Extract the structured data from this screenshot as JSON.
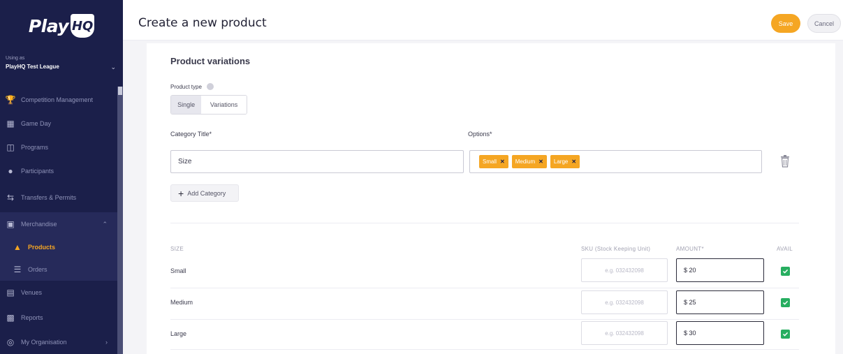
{
  "brand": {
    "play": "Play",
    "hq": "HQ"
  },
  "org": {
    "caption": "Using as",
    "name": "PlayHQ Test League"
  },
  "sidebar": {
    "items": [
      {
        "label": "Competition Management",
        "icon": "trophy-icon"
      },
      {
        "label": "Game Day",
        "icon": "calendar-icon"
      },
      {
        "label": "Programs",
        "icon": "book-icon"
      },
      {
        "label": "Participants",
        "icon": "people-icon"
      },
      {
        "label": "Transfers & Permits",
        "icon": "transfer-icon"
      },
      {
        "label": "Merchandise",
        "icon": "box-icon"
      },
      {
        "label": "Products",
        "icon": "shirt-icon"
      },
      {
        "label": "Orders",
        "icon": "list-icon"
      },
      {
        "label": "Venues",
        "icon": "venue-icon"
      },
      {
        "label": "Reports",
        "icon": "report-icon"
      },
      {
        "label": "My Organisation",
        "icon": "globe-icon"
      }
    ]
  },
  "header": {
    "title": "Create a new product",
    "save": "Save",
    "cancel": "Cancel"
  },
  "form": {
    "section_title": "Product variations",
    "product_type_label": "Product type",
    "product_type_options": [
      "Single",
      "Variations"
    ],
    "category_title_label": "Category Title*",
    "options_label": "Options*",
    "category_value": "Size",
    "options": [
      "Small",
      "Medium",
      "Large"
    ],
    "add_category": "Add Category"
  },
  "table": {
    "headers": {
      "size": "SIZE",
      "sku": "SKU (Stock Keeping Unit)",
      "amount": "AMOUNT*",
      "avail": "AVAIL"
    },
    "rows": [
      {
        "size": "Small",
        "sku_placeholder": "e.g. 032432098",
        "amount": "$ 20",
        "available": true
      },
      {
        "size": "Medium",
        "sku_placeholder": "e.g. 032432098",
        "amount": "$ 25",
        "available": true
      },
      {
        "size": "Large",
        "sku_placeholder": "e.g. 032432098",
        "amount": "$ 30",
        "available": true
      }
    ]
  },
  "colors": {
    "sidebar": "#1b1f4a",
    "accent": "#f5a623",
    "check": "#27ae60"
  }
}
